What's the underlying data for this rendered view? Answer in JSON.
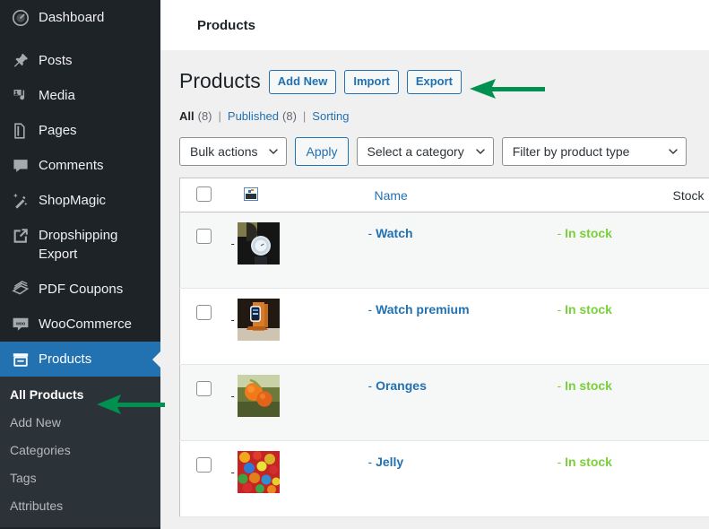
{
  "app": {
    "name": "WordPress Admin",
    "accent_blue": "#2271b1",
    "sidebar_bg": "#1d2327",
    "submenu_bg": "#2c3338",
    "content_bg": "#f0f0f1",
    "arrow_green": "#009150",
    "instock_green": "#7ad03a"
  },
  "adminbar": {
    "breadcrumb": "Products"
  },
  "sidebar": {
    "items": [
      {
        "label": "Dashboard",
        "icon": "dashboard-icon",
        "active": false
      },
      {
        "label": "Posts",
        "icon": "pin-icon",
        "active": false
      },
      {
        "label": "Media",
        "icon": "media-icon",
        "active": false
      },
      {
        "label": "Pages",
        "icon": "pages-icon",
        "active": false
      },
      {
        "label": "Comments",
        "icon": "comments-icon",
        "active": false
      },
      {
        "label": "ShopMagic",
        "icon": "wand-icon",
        "active": false
      },
      {
        "label": "Dropshipping Export",
        "icon": "external-link-icon",
        "active": false
      },
      {
        "label": "PDF Coupons",
        "icon": "coupons-icon",
        "active": false
      },
      {
        "label": "WooCommerce",
        "icon": "woocommerce-icon",
        "active": false
      },
      {
        "label": "Products",
        "icon": "products-icon",
        "active": true
      }
    ],
    "submenu": [
      {
        "label": "All Products",
        "current": true
      },
      {
        "label": "Add New",
        "current": false
      },
      {
        "label": "Categories",
        "current": false
      },
      {
        "label": "Tags",
        "current": false
      },
      {
        "label": "Attributes",
        "current": false
      }
    ]
  },
  "page": {
    "title": "Products",
    "actions": [
      {
        "label": "Add New"
      },
      {
        "label": "Import"
      },
      {
        "label": "Export"
      }
    ],
    "views": {
      "all_label": "All",
      "all_count": "(8)",
      "sep1": "|",
      "published_label": "Published",
      "published_count": "(8)",
      "sep2": "|",
      "sorting_label": "Sorting"
    },
    "filters": {
      "bulk_actions": "Bulk actions",
      "apply": "Apply",
      "category": "Select a category",
      "product_type": "Filter by product type"
    }
  },
  "table": {
    "columns": {
      "checkbox": "",
      "image": "image-icon",
      "name": "Name",
      "stock": "Stock"
    },
    "rows": [
      {
        "prefix": "-",
        "name": "Watch",
        "stock_prefix": "-",
        "stock": "In stock",
        "thumb": "watch"
      },
      {
        "prefix": "-",
        "name": "Watch premium",
        "stock_prefix": "-",
        "stock": "In stock",
        "thumb": "watch-premium"
      },
      {
        "prefix": "-",
        "name": "Oranges",
        "stock_prefix": "-",
        "stock": "In stock",
        "thumb": "oranges"
      },
      {
        "prefix": "-",
        "name": "Jelly",
        "stock_prefix": "-",
        "stock": "In stock",
        "thumb": "jelly"
      }
    ]
  },
  "annotations": [
    {
      "name": "arrow-pointing-to-export-button",
      "direction": "left"
    },
    {
      "name": "arrow-pointing-to-all-products",
      "direction": "left"
    }
  ]
}
